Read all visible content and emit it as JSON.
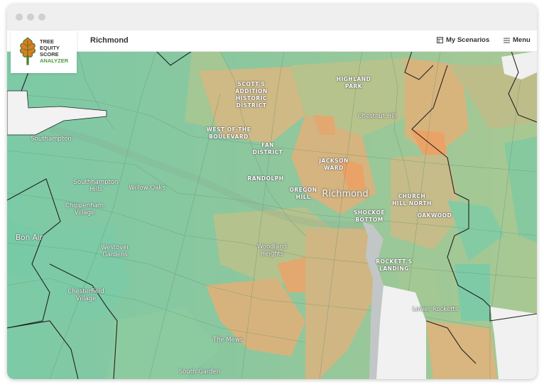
{
  "header": {
    "place": "Richmond",
    "my_scenarios": "My Scenarios",
    "menu": "Menu"
  },
  "logo": {
    "line1": "TREE",
    "line2": "EQUITY",
    "line3": "SCORE",
    "line4": "ANALYZER"
  },
  "colors": {
    "high_score": "#7cc9a3",
    "mid_score": "#a9c892",
    "low_score": "#d7b47e",
    "lowest_score": "#eba266",
    "water": "#f2f2f2"
  },
  "map_labels": {
    "city": "Richmond",
    "scotts_addition": "SCOTT'S\nADDITION\nHISTORIC\nDISTRICT",
    "highland_park": "HIGHLAND\nPARK",
    "chestnut_hill": "Chestnut Hill",
    "west_boulevard": "WEST OF THE\nBOULEVARD",
    "fan_district": "FAN\nDISTRICT",
    "jackson_ward": "JACKSON\nWARD",
    "randolph": "RANDOLPH",
    "oregon_hill": "OREGON\nHILL",
    "church_hill_north": "CHURCH\nHILL NORTH",
    "shockoe_bottom": "SHOCKOE\nBOTTOM",
    "oakwood": "OAKWOOD",
    "rocketts_landing": "ROCKETT'S\nLANDING",
    "southampton": "Southampton",
    "southhampton_hills": "Southhampton\nHills",
    "willow_oaks": "Willow Oaks",
    "chippenham_village": "Chippenham\nVillage",
    "bon_air": "Bon Air",
    "westover_gardens": "Westover\nGardens",
    "woodland_heights": "Woodland\nHeights",
    "chesterfield_village": "Chesterfield\nVillage",
    "lower_rocketts": "Lower Rocketts",
    "the_mews": "The Mews",
    "south_garden": "South Garden"
  }
}
